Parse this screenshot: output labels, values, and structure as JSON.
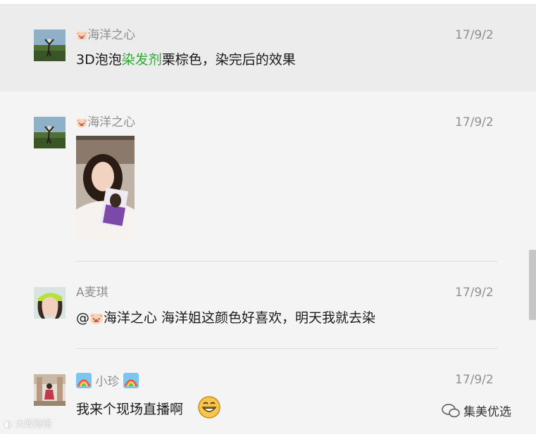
{
  "messages": [
    {
      "author": "海洋之心",
      "author_badge": "pig-emoji",
      "date": "17/9/2",
      "text_before": "3D泡泡",
      "text_highlight": "染发剂",
      "text_after": "栗棕色，染完后的效果",
      "highlighted": true
    },
    {
      "author": "海洋之心",
      "author_badge": "pig-emoji",
      "date": "17/9/2",
      "attachment": "photo"
    },
    {
      "author": "A麦琪",
      "date": "17/9/2",
      "mention_prefix": "@",
      "mention_name": "海洋之心",
      "text": " 海洋姐这颜色好喜欢，明天我就去染"
    },
    {
      "author": "小珍",
      "author_badges": [
        "rainbow-emoji",
        "rainbow-emoji"
      ],
      "date": "17/9/2",
      "text": "我来个现场直播啊",
      "emoji": "grinning-face-emoji"
    }
  ],
  "watermark_left": "大政跨境",
  "watermark_right": "集美优选",
  "colors": {
    "highlight_text": "#2eaa2e",
    "background": "#f4f4f4",
    "highlight_row": "#ececec"
  }
}
